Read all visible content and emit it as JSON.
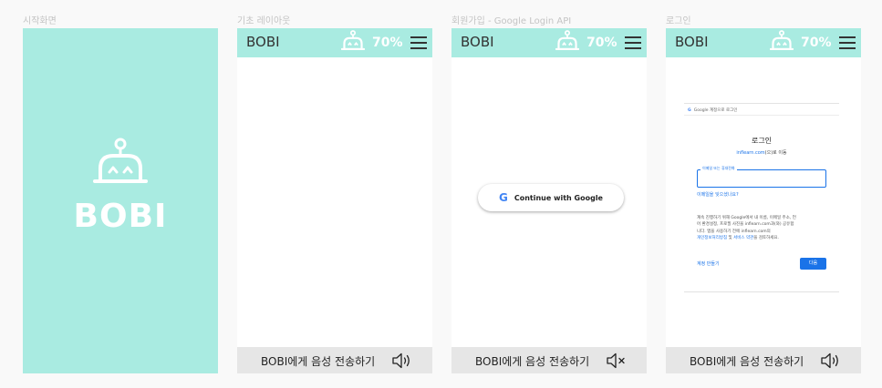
{
  "frames": [
    {
      "title": "시작화면"
    },
    {
      "title": "기초 레이아웃"
    },
    {
      "title": "회원가입 - Google Login API"
    },
    {
      "title": "로그인"
    }
  ],
  "app": {
    "logo": "BOBI",
    "battery": "70%",
    "bottom_label": "BOBI에게 음성 전송하기",
    "accent_color": "#a9ebe1"
  },
  "splash": {
    "title": "BOBI"
  },
  "google_button": {
    "icon": "G",
    "label": "Continue with Google"
  },
  "login": {
    "header_icon": "G",
    "header": "Google 계정으로 로그인",
    "title": "로그인",
    "sub_domain": "inflearn.com",
    "sub_rest": "(으)로 이동",
    "input_label": "이메일 또는 휴대전화",
    "input_value": "",
    "forgot": "이메일을 잊으셨나요?",
    "info_lines": [
      "계속 진행하기 위해 Google에서 내 이름, 이메일 주소, 언",
      "어 환경설정, 프로필 사진을 inflearn.com과(와) 공유합",
      "니다. 앱을 사용하기 전에 inflearn.com의"
    ],
    "info_link_privacy": "개인정보처리방침",
    "info_mid": " 및 ",
    "info_link_terms": "서비스 약관",
    "info_tail": "을 검토하세요.",
    "create_account": "계정 만들기",
    "next": "다음"
  }
}
